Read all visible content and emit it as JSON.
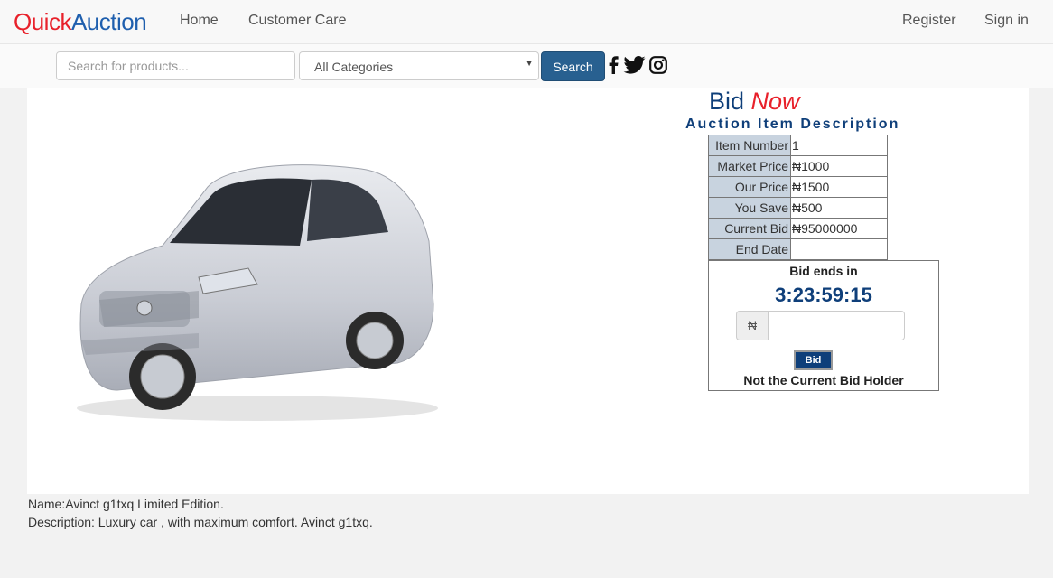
{
  "brand": {
    "part1": "Quick",
    "part2": "Auction"
  },
  "nav": {
    "home": "Home",
    "customer_care": "Customer Care",
    "register": "Register",
    "sign_in": "Sign in"
  },
  "search": {
    "placeholder": "Search for products...",
    "category_selected": "All Categories",
    "button_label": "Search"
  },
  "social": {
    "icons": [
      "facebook-icon",
      "twitter-icon",
      "instagram-icon"
    ]
  },
  "bid": {
    "title_part1": "Bid",
    "title_part2": "Now",
    "description_title": "Auction Item Description",
    "rows": [
      {
        "label": "Item Number",
        "value": "1"
      },
      {
        "label": "Market Price",
        "value": "₦1000"
      },
      {
        "label": "Our Price",
        "value": "₦1500"
      },
      {
        "label": "You Save",
        "value": "₦500"
      },
      {
        "label": "Current Bid",
        "value": "₦95000000"
      },
      {
        "label": "End Date",
        "value": ""
      }
    ],
    "ends_label": "Bid ends in",
    "countdown": "3:23:59:15",
    "currency_symbol": "₦",
    "button_label": "Bid",
    "holder_status": "Not the Current Bid Holder"
  },
  "item": {
    "name": "Name:Avinct g1txq Limited Edition.",
    "description": "Description: Luxury car , with maximum comfort. Avinct g1txq."
  },
  "colors": {
    "brand_red": "#e8212b",
    "brand_blue": "#1f5fae",
    "search_button": "#286090",
    "bid_navy": "#0f3f7a",
    "label_cell": "#c8d3df"
  }
}
